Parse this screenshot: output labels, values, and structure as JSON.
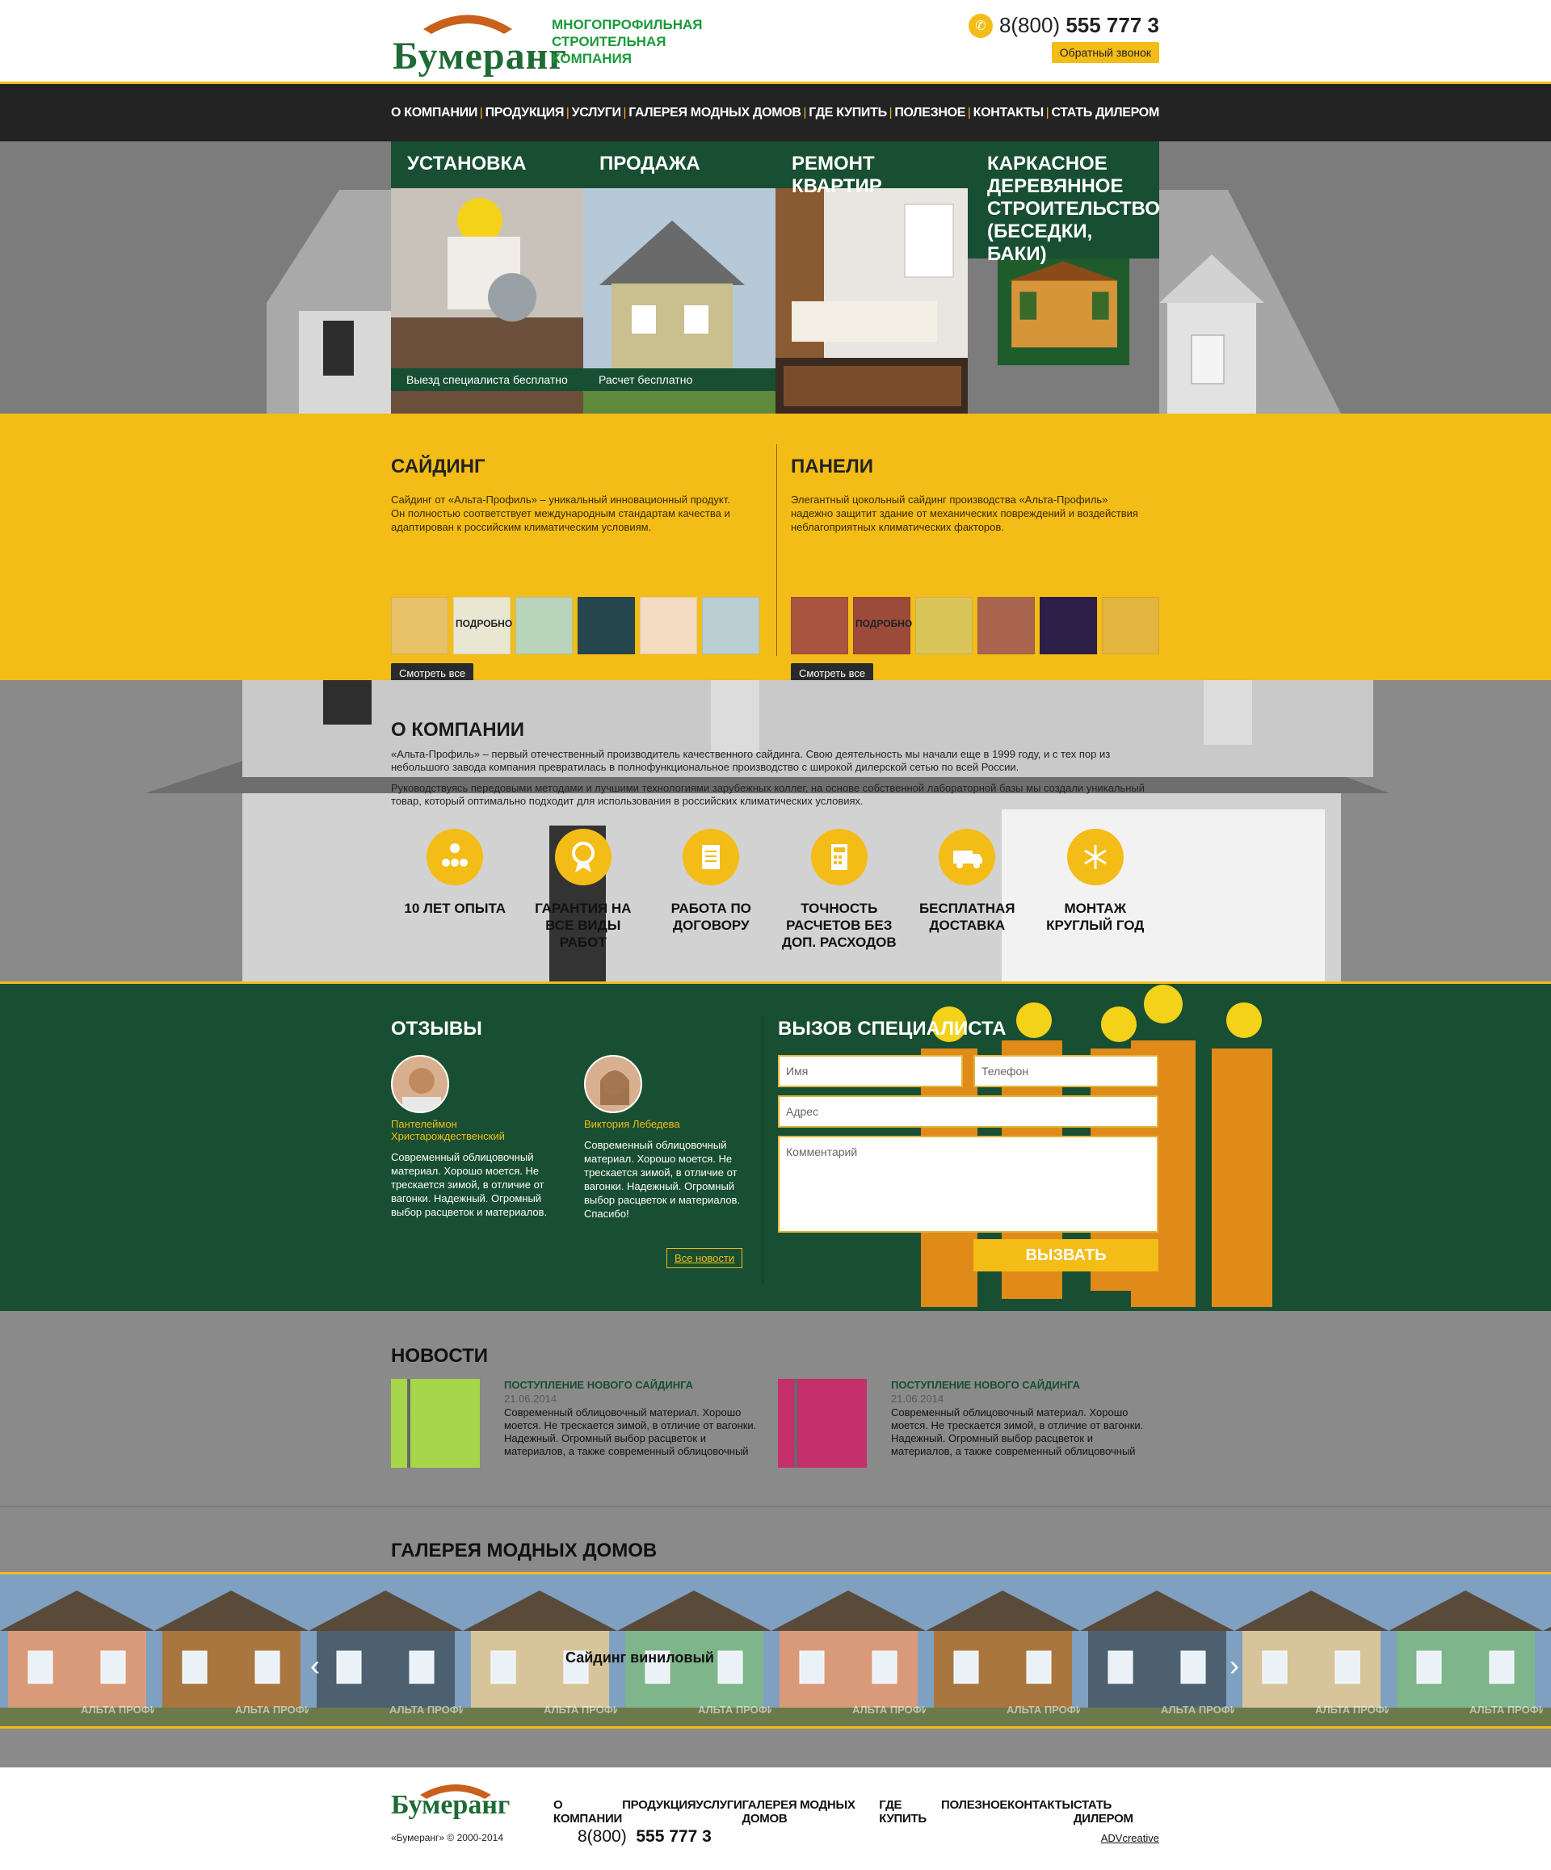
{
  "header": {
    "logo_text": "Бумеранг",
    "tagline": "Многопрофильная строительная компания",
    "phone_prefix": "8(800)",
    "phone_number": "555 777 3",
    "callback_label": "Обратный звонок"
  },
  "nav": {
    "items": [
      "О компании",
      "Продукция",
      "Услуги",
      "Галерея модных домов",
      "Где купить",
      "Полезное",
      "Контакты",
      "Стать дилером"
    ]
  },
  "services": [
    {
      "title": "Установка",
      "caption": "Выезд специалиста бесплатно"
    },
    {
      "title": "Продажа",
      "caption": "Расчет бесплатно"
    },
    {
      "title": "Ремонт квартир",
      "caption": ""
    },
    {
      "title": "Каркасное деревянное строительство (беседки, баки)",
      "caption": ""
    }
  ],
  "products": {
    "siding": {
      "title": "Сайдинг",
      "text": "Сайдинг от «Альта-Профиль» – уникальный инновационный продукт. Он полностью соответствует международным стандартам качества и адаптирован к российским климатическим условиям.",
      "more_label": "подробно",
      "see_all": "Смотреть все",
      "swatch_colors": [
        "#e8c067",
        "#e9e6d2",
        "#b8d4ba",
        "#26474d",
        "#f4dcc0",
        "#b9cfd4"
      ]
    },
    "panels": {
      "title": "Панели",
      "text": "Элегантный цокольный сайдинг производства «Альта-Профиль» надежно защитит здание от механических повреждений и воздействия неблагоприятных климатических факторов.",
      "more_label": "подробно",
      "see_all": "Смотреть все",
      "swatch_colors": [
        "#a8543e",
        "#9c4a3a",
        "#d9c45a",
        "#a9654e",
        "#2d2048",
        "#e3b43e"
      ]
    }
  },
  "about": {
    "title": "О компании",
    "p1": "«Альта-Профиль» – первый отечественный производитель качественного сайдинга. Свою деятельность мы начали еще в 1999 году, и с тех пор из небольшого завода компания превратилась в полнофункциональное производство с широкой дилерской сетью по всей России.",
    "p2": "Руководствуясь передовыми методами и лучшими технологиями зарубежных коллег, на основе собственной лабораторной базы мы создали уникальный товар, который оптимально подходит для использования в российских климатических условиях.",
    "features": [
      {
        "icon": "team-icon",
        "label": "10 лет опыта"
      },
      {
        "icon": "award-icon",
        "label": "Гарантия на все виды работ"
      },
      {
        "icon": "document-icon",
        "label": "Работа по договору"
      },
      {
        "icon": "calculator-icon",
        "label": "Точность расчетов без доп. расходов"
      },
      {
        "icon": "truck-icon",
        "label": "Бесплатная доставка"
      },
      {
        "icon": "snowflake-icon",
        "label": "Монтаж круглый год"
      }
    ]
  },
  "reviews": {
    "title": "Отзывы",
    "items": [
      {
        "name": "Пантелеймон Христарождественский",
        "text": "Современный облицовочный материал. Хорошо моется. Не трескается зимой, в отличие от вагонки. Надежный. Огромный выбор расцветок и материалов."
      },
      {
        "name": "Виктория Лебедева",
        "text": "Современный облицовочный материал. Хорошо моется. Не трескается зимой, в отличие от вагонки. Надежный. Огромный выбор расцветок и материалов. Спасибо!"
      }
    ],
    "all_label": "Все новости"
  },
  "call_form": {
    "title": "Вызов специалиста",
    "name_placeholder": "Имя",
    "phone_placeholder": "Телефон",
    "address_placeholder": "Адрес",
    "comment_placeholder": "Комментарий",
    "submit_label": "Вызвать"
  },
  "news": {
    "title": "Новости",
    "items": [
      {
        "headline": "Поступление нового сайдинга",
        "date": "21.06.2014",
        "text": "Современный облицовочный материал. Хорошо моется. Не трескается зимой, в отличие от вагонки. Надежный. Огромный выбор расцветок и материалов, а также современный облицовочный материал. Хорошо моется. Не трескается зимой, в отличие от",
        "thumb_color": "#a6d64a"
      },
      {
        "headline": "Поступление нового сайдинга",
        "date": "21.06.2014",
        "text": "Современный облицовочный материал. Хорошо моется. Не трескается зимой, в отличие от вагонки. Надежный. Огромный выбор расцветок и материалов, а также современный облицовочный материал. Хорошо моется. Не трескается зимой, в",
        "thumb_color": "#c42e6a"
      }
    ]
  },
  "gallery": {
    "title": "Галерея модных домов",
    "caption": "Сайдинг виниловый",
    "watermark": "Альта Профиль",
    "prev_label": "‹",
    "next_label": "›"
  },
  "footer": {
    "logo_text": "Бумеранг",
    "copyright": "«Бумеранг» © 2000-2014",
    "nav": [
      "О компании",
      "Продукция",
      "Услуги",
      "Галерея модных домов",
      "Где купить",
      "Полезное",
      "Контакты",
      "Стать дилером"
    ],
    "phone_prefix": "8(800)",
    "phone_number": "555 777 3",
    "credit": "ADVcreative"
  },
  "colors": {
    "accent": "#f3bc17",
    "green": "#184e32",
    "dark": "#232323",
    "gray": "#8a8a8a"
  }
}
